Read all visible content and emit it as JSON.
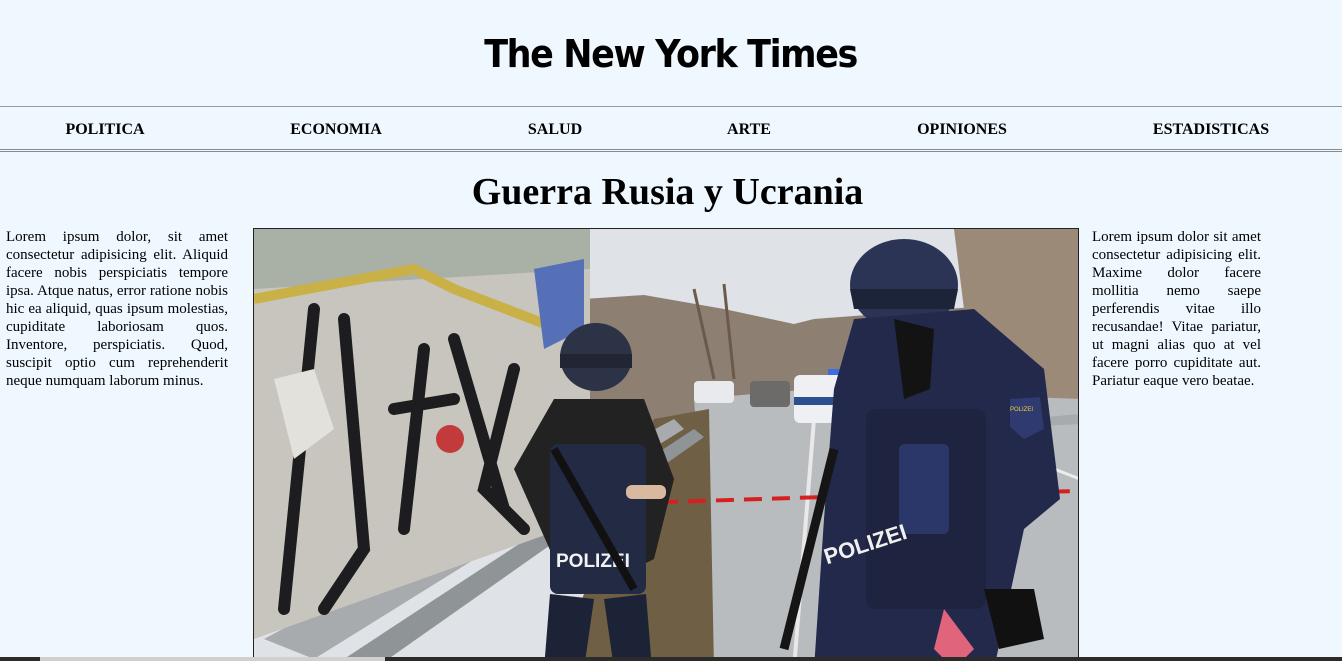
{
  "masthead": {
    "title": "The New York Times"
  },
  "nav": {
    "items": [
      {
        "label": "POLITICA"
      },
      {
        "label": "ECONOMIA"
      },
      {
        "label": "SALUD"
      },
      {
        "label": "ARTE"
      },
      {
        "label": "OPINIONES"
      },
      {
        "label": "ESTADISTICAS"
      }
    ]
  },
  "article": {
    "headline": "Guerra Rusia y Ucrania",
    "left_text": "Lorem ipsum dolor, sit amet consectetur adipisicing elit. Aliquid facere nobis perspiciatis tempore ipsa. Atque natus, error ratione nobis hic ea aliquid, quas ipsum molestias, cupiditate laboriosam quos. Inventore, perspiciatis. Quod, suscipit optio cum reprehenderit neque numquam laborum minus.",
    "right_text": "Lorem ipsum dolor sit amet consectetur adipisicing elit. Maxime dolor facere mollitia nemo saepe perferendis vitae illo recusandae! Vitae pariatur, ut magni alias quo at vel facere porro cupiditate aut. Pariatur eaque vero beatae.",
    "photo": {
      "vest_text_left": "POLIZEI",
      "vest_text_right": "POLIZEI",
      "badge_text": "POLIZEI"
    }
  }
}
